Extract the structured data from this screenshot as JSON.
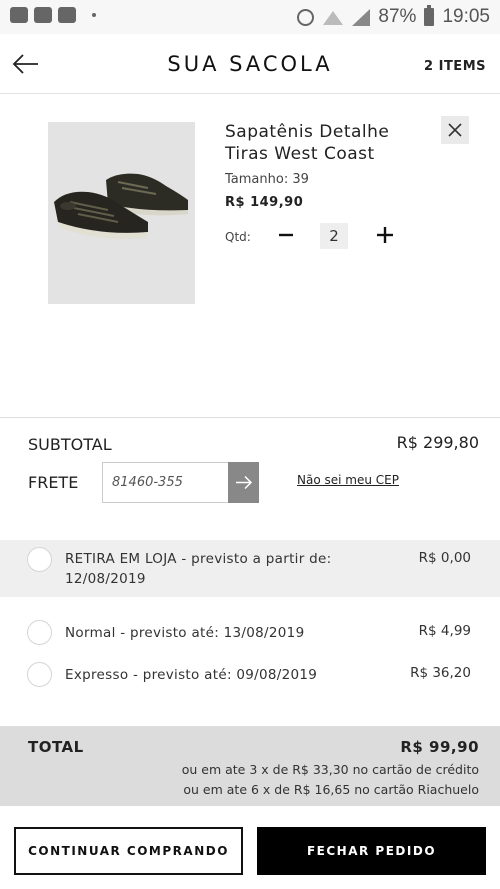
{
  "status_bar": {
    "battery": "87%",
    "time": "19:05"
  },
  "header": {
    "title": "SUA SACOLA",
    "items_count": "2 ITEMS"
  },
  "product": {
    "name": "Sapatênis Detalhe Tiras West Coast",
    "size": "Tamanho: 39",
    "price": "R$ 149,90",
    "qty_label": "Qtd:",
    "qty_value": "2",
    "image": "black-sneakers-photo"
  },
  "summary": {
    "subtotal_label": "SUBTOTAL",
    "subtotal_value": "R$ 299,80",
    "frete_label": "FRETE",
    "cep_value": "81460-355",
    "cep_link": "Não sei meu CEP"
  },
  "shipping_options": [
    {
      "text": "RETIRA EM LOJA - previsto a partir de: 12/08/2019",
      "price": "R$ 0,00"
    },
    {
      "text": "Normal - previsto até: 13/08/2019",
      "price": "R$ 4,99"
    },
    {
      "text": "Expresso - previsto até: 09/08/2019",
      "price": "R$ 36,20"
    }
  ],
  "total": {
    "label": "TOTAL",
    "value": "R$ 99,90",
    "installments_credit": "ou em ate 3 x de R$ 33,30 no cartão de crédito",
    "installments_store": "ou em ate 6 x de R$ 16,65 no cartão Riachuelo"
  },
  "buttons": {
    "continue": "CONTINUAR COMPRANDO",
    "checkout": "FECHAR PEDIDO"
  },
  "colors": {
    "checkout_bg": "#000000",
    "total_bg": "#dcdcdc",
    "shaded_row": "#efefef"
  }
}
